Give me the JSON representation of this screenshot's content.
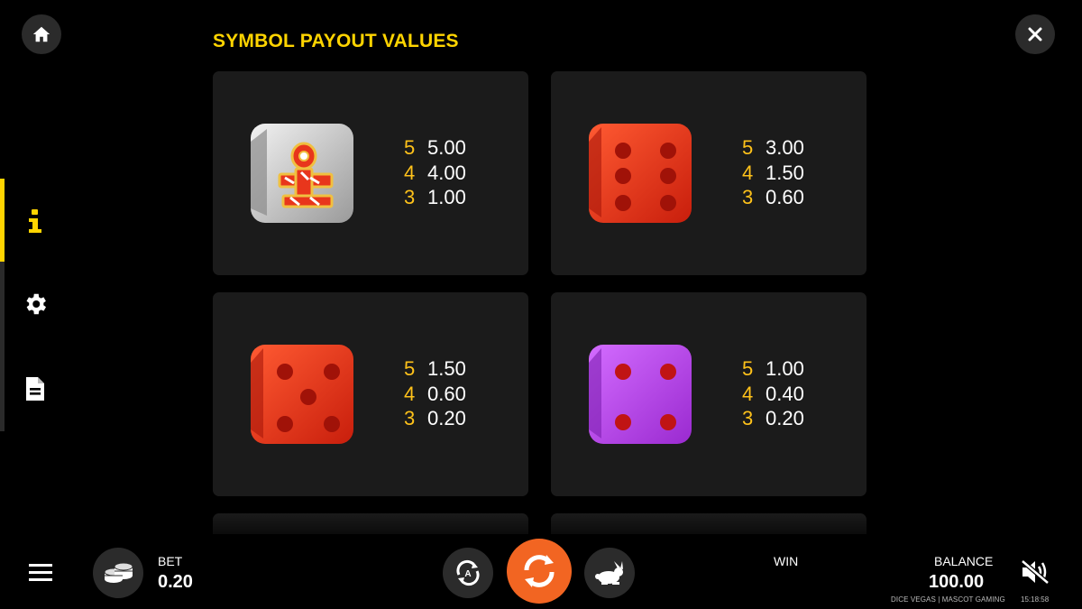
{
  "header": {
    "title": "SYMBOL PAYOUT VALUES"
  },
  "icons": {
    "home": "home-icon",
    "close": "close-icon",
    "info": "info-icon",
    "settings": "gear-icon",
    "rules": "document-icon",
    "menu": "hamburger-menu-icon",
    "bet": "coin-stack-icon",
    "autoplay": "autoplay-icon",
    "spin": "spin-icon",
    "turbo": "rabbit-icon",
    "sound": "sound-muted-icon"
  },
  "colors": {
    "accent": "#ffd400",
    "payout_count": "#ffc21a",
    "spin": "#f26522",
    "card_bg": "#1b1b1b",
    "die_red": "#e8361c",
    "die_purple": "#b43fe8",
    "die_silver": "#d9d9d9"
  },
  "symbols": [
    {
      "symbol": "wild-silver-die",
      "payouts": [
        {
          "count": "5",
          "value": "5.00"
        },
        {
          "count": "4",
          "value": "4.00"
        },
        {
          "count": "3",
          "value": "1.00"
        }
      ]
    },
    {
      "symbol": "red-die-six",
      "payouts": [
        {
          "count": "5",
          "value": "3.00"
        },
        {
          "count": "4",
          "value": "1.50"
        },
        {
          "count": "3",
          "value": "0.60"
        }
      ]
    },
    {
      "symbol": "red-die-five",
      "payouts": [
        {
          "count": "5",
          "value": "1.50"
        },
        {
          "count": "4",
          "value": "0.60"
        },
        {
          "count": "3",
          "value": "0.20"
        }
      ]
    },
    {
      "symbol": "purple-die-four",
      "payouts": [
        {
          "count": "5",
          "value": "1.00"
        },
        {
          "count": "4",
          "value": "0.40"
        },
        {
          "count": "3",
          "value": "0.20"
        }
      ]
    }
  ],
  "footer": {
    "bet_label": "BET",
    "bet_value": "0.20",
    "win_label": "WIN",
    "balance_label": "BALANCE",
    "balance_value": "100.00",
    "brand": "DICE VEGAS | MASCOT GAMING",
    "time": "15:18:58"
  }
}
